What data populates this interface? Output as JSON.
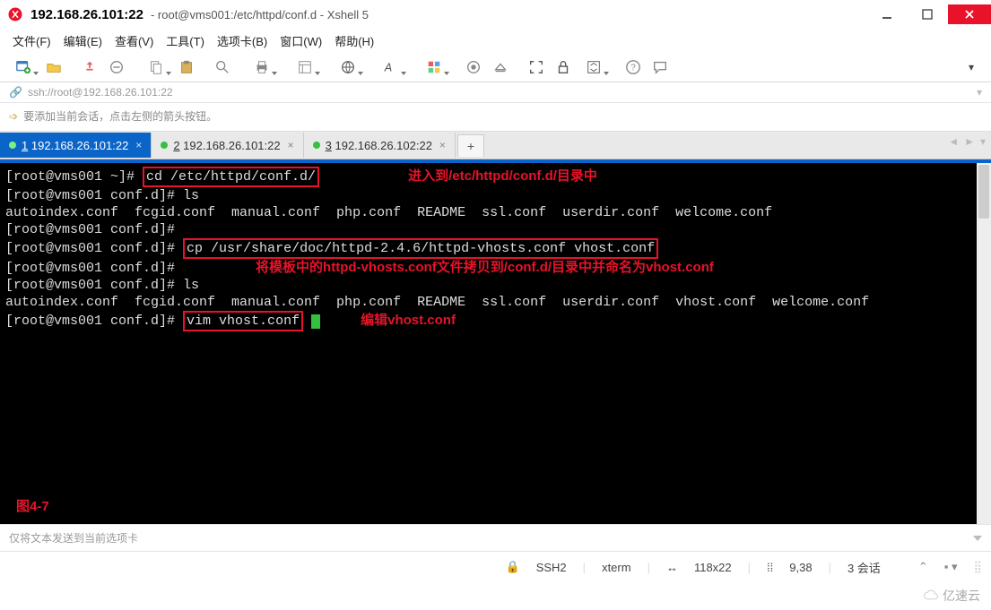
{
  "titlebar": {
    "ip": "192.168.26.101:22",
    "rest": "root@vms001:/etc/httpd/conf.d - Xshell 5"
  },
  "menu": {
    "file": "文件(F)",
    "edit": "编辑(E)",
    "view": "查看(V)",
    "tools": "工具(T)",
    "tabs": "选项卡(B)",
    "window": "窗口(W)",
    "help": "帮助(H)"
  },
  "address": "ssh://root@192.168.26.101:22",
  "hint": "要添加当前会话，点击左侧的箭头按钮。",
  "tabs": [
    {
      "num": "1",
      "label": "192.168.26.101:22",
      "active": true
    },
    {
      "num": "2",
      "label": "192.168.26.101:22",
      "active": false
    },
    {
      "num": "3",
      "label": "192.168.26.102:22",
      "active": false
    }
  ],
  "term": {
    "l1_prompt": "[root@vms001 ~]# ",
    "l1_cmd": "cd /etc/httpd/conf.d/",
    "ann1": "进入到/etc/httpd/conf.d/目录中",
    "l2": "[root@vms001 conf.d]# ls",
    "l3": "autoindex.conf  fcgid.conf  manual.conf  php.conf  README  ssl.conf  userdir.conf  welcome.conf",
    "l4": "[root@vms001 conf.d]#",
    "l5_prompt": "[root@vms001 conf.d]# ",
    "l5_cmd": "cp /usr/share/doc/httpd-2.4.6/httpd-vhosts.conf vhost.conf",
    "l6": "[root@vms001 conf.d]#",
    "ann2": "将模板中的httpd-vhosts.conf文件拷贝到/conf.d/目录中并命名为vhost.conf",
    "l7": "[root@vms001 conf.d]# ls",
    "l8": "autoindex.conf  fcgid.conf  manual.conf  php.conf  README  ssl.conf  userdir.conf  vhost.conf  welcome.conf",
    "l9_prompt": "[root@vms001 conf.d]# ",
    "l9_cmd": "vim vhost.conf",
    "ann3": "编辑vhost.conf",
    "fig": "图4-7"
  },
  "sendbar": "仅将文本发送到当前选项卡",
  "status": {
    "proto": "SSH2",
    "termtype": "xterm",
    "size": "118x22",
    "cursor": "9,38",
    "sessions": "3 会话"
  },
  "brand": "亿速云"
}
